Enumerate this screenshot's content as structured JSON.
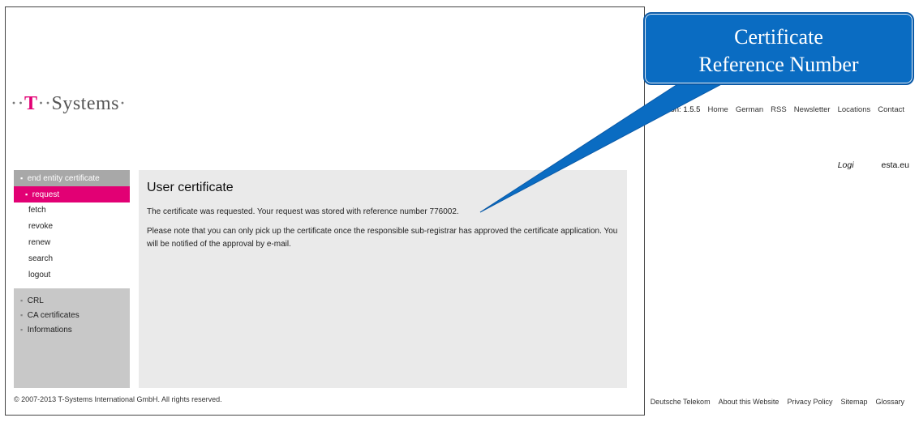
{
  "header": {
    "logo_prefix": "··",
    "logo_t": "T",
    "logo_mid": "··",
    "logo_name": "Systems",
    "logo_suffix": "·",
    "nav": [
      "Version: 1.5.5",
      "Home",
      "German",
      "RSS",
      "Newsletter",
      "Locations",
      "Contact"
    ],
    "login_label": "Logi",
    "login_domain": "esta.eu"
  },
  "sidebar": {
    "section_head": "end entity certificate",
    "sub_items": [
      "request",
      "fetch",
      "revoke",
      "renew",
      "search",
      "logout"
    ],
    "active_item": "request",
    "bottom_items": [
      "CRL",
      "CA certificates",
      "Informations"
    ]
  },
  "main": {
    "title": "User certificate",
    "para1": "The certificate was requested. Your request was stored with reference number 776002.",
    "para2": "Please note that you can only pick up the certificate once the responsible sub-registrar has approved the certificate application. You will be notified of the approval by e-mail."
  },
  "footer": {
    "copyright": "© 2007-2013 T-Systems International GmbH. All rights reserved.",
    "links": [
      "Deutsche Telekom",
      "About this Website",
      "Privacy Policy",
      "Sitemap",
      "Glossary"
    ]
  },
  "callout": {
    "line1": "Certificate",
    "line2": "Reference Number"
  },
  "colors": {
    "accent_magenta": "#e20074",
    "callout_blue": "#0a6cc2",
    "sidebar_gray": "#c8c8c8",
    "content_gray": "#eaeaea"
  }
}
